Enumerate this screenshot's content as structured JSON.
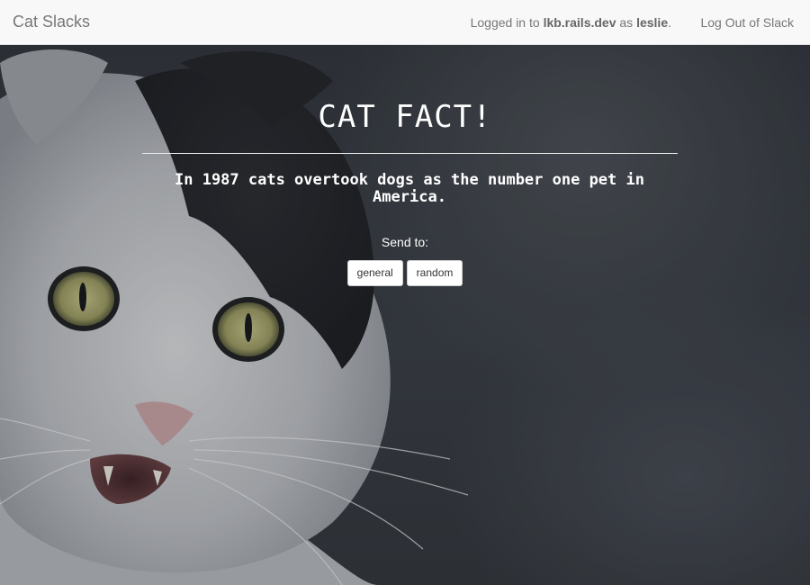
{
  "navbar": {
    "brand": "Cat Slacks",
    "logged_in_prefix": "Logged in to ",
    "team_domain": "lkb.rails.dev",
    "as_text": " as ",
    "username": "leslie",
    "period": ".",
    "logout_label": "Log Out of Slack"
  },
  "main": {
    "title": "CAT FACT!",
    "fact": "In 1987 cats overtook dogs as the number one pet in America.",
    "send_to_label": "Send to:",
    "channels": [
      "general",
      "random"
    ]
  },
  "background": {
    "subject": "cat-photo"
  }
}
